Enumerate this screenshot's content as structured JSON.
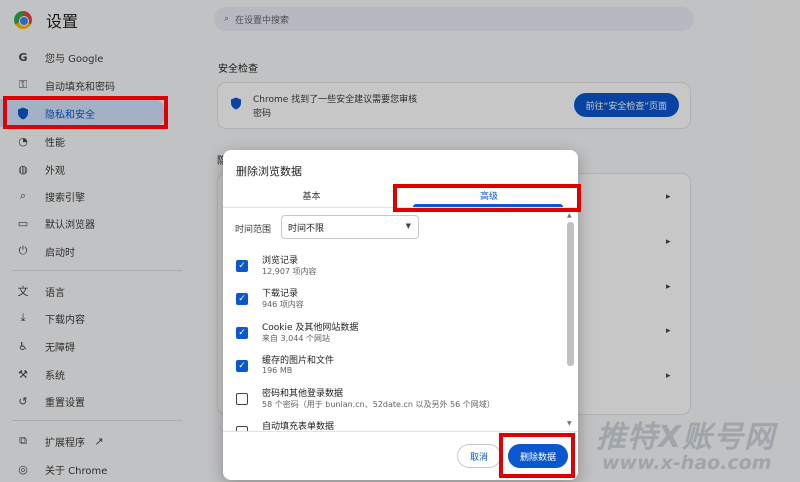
{
  "app": {
    "title": "设置"
  },
  "search": {
    "placeholder": "在设置中搜索",
    "icon": "search-icon"
  },
  "sidebar": {
    "items": [
      {
        "label": "您与 Google",
        "icon": "google-g-icon"
      },
      {
        "label": "自动填充和密码",
        "icon": "key-icon"
      },
      {
        "label": "隐私和安全",
        "icon": "shield-icon",
        "active": true
      },
      {
        "label": "性能",
        "icon": "speedometer-icon"
      },
      {
        "label": "外观",
        "icon": "palette-icon"
      },
      {
        "label": "搜索引擎",
        "icon": "search-icon"
      },
      {
        "label": "默认浏览器",
        "icon": "browser-window-icon"
      },
      {
        "label": "启动时",
        "icon": "power-icon"
      },
      {
        "label": "语言",
        "icon": "translate-icon"
      },
      {
        "label": "下载内容",
        "icon": "download-icon"
      },
      {
        "label": "无障碍",
        "icon": "accessibility-icon"
      },
      {
        "label": "系统",
        "icon": "wrench-icon"
      },
      {
        "label": "重置设置",
        "icon": "reset-icon"
      },
      {
        "label": "扩展程序",
        "icon": "puzzle-icon"
      },
      {
        "label": "关于 Chrome",
        "icon": "chrome-icon"
      }
    ]
  },
  "main": {
    "safety_check": {
      "section_title": "安全检查",
      "message_line1": "Chrome 找到了一些安全建议需要您审核",
      "message_line2": "密码",
      "button": "前往“安全检查”页面"
    },
    "partial_heading": "隐"
  },
  "dialog": {
    "title": "删除浏览数据",
    "tabs": [
      {
        "label": "基本"
      },
      {
        "label": "高级",
        "selected": true
      }
    ],
    "time_range": {
      "label": "时间范围",
      "value": "时间不限"
    },
    "options": [
      {
        "title": "浏览记录",
        "subtitle": "12,907 项内容",
        "checked": true
      },
      {
        "title": "下载记录",
        "subtitle": "946 项内容",
        "checked": true
      },
      {
        "title": "Cookie 及其他网站数据",
        "subtitle": "来自 3,044 个网站",
        "checked": true
      },
      {
        "title": "缓存的图片和文件",
        "subtitle": "196 MB",
        "checked": true
      },
      {
        "title": "密码和其他登录数据",
        "subtitle": "58 个密码（用于 bunian.cn、52date.cn 以及另外 56 个网域）",
        "checked": false
      },
      {
        "title": "自动填充表单数据",
        "subtitle": "",
        "checked": false
      }
    ],
    "cancel_label": "取消",
    "delete_label": "删除数据"
  },
  "watermark": {
    "line1": "推特X账号网",
    "line2": "www.x-hao.com"
  },
  "colors": {
    "accent": "#0b57d0",
    "highlight_box": "#e00000",
    "active_nav_bg": "#d3e3fd"
  }
}
